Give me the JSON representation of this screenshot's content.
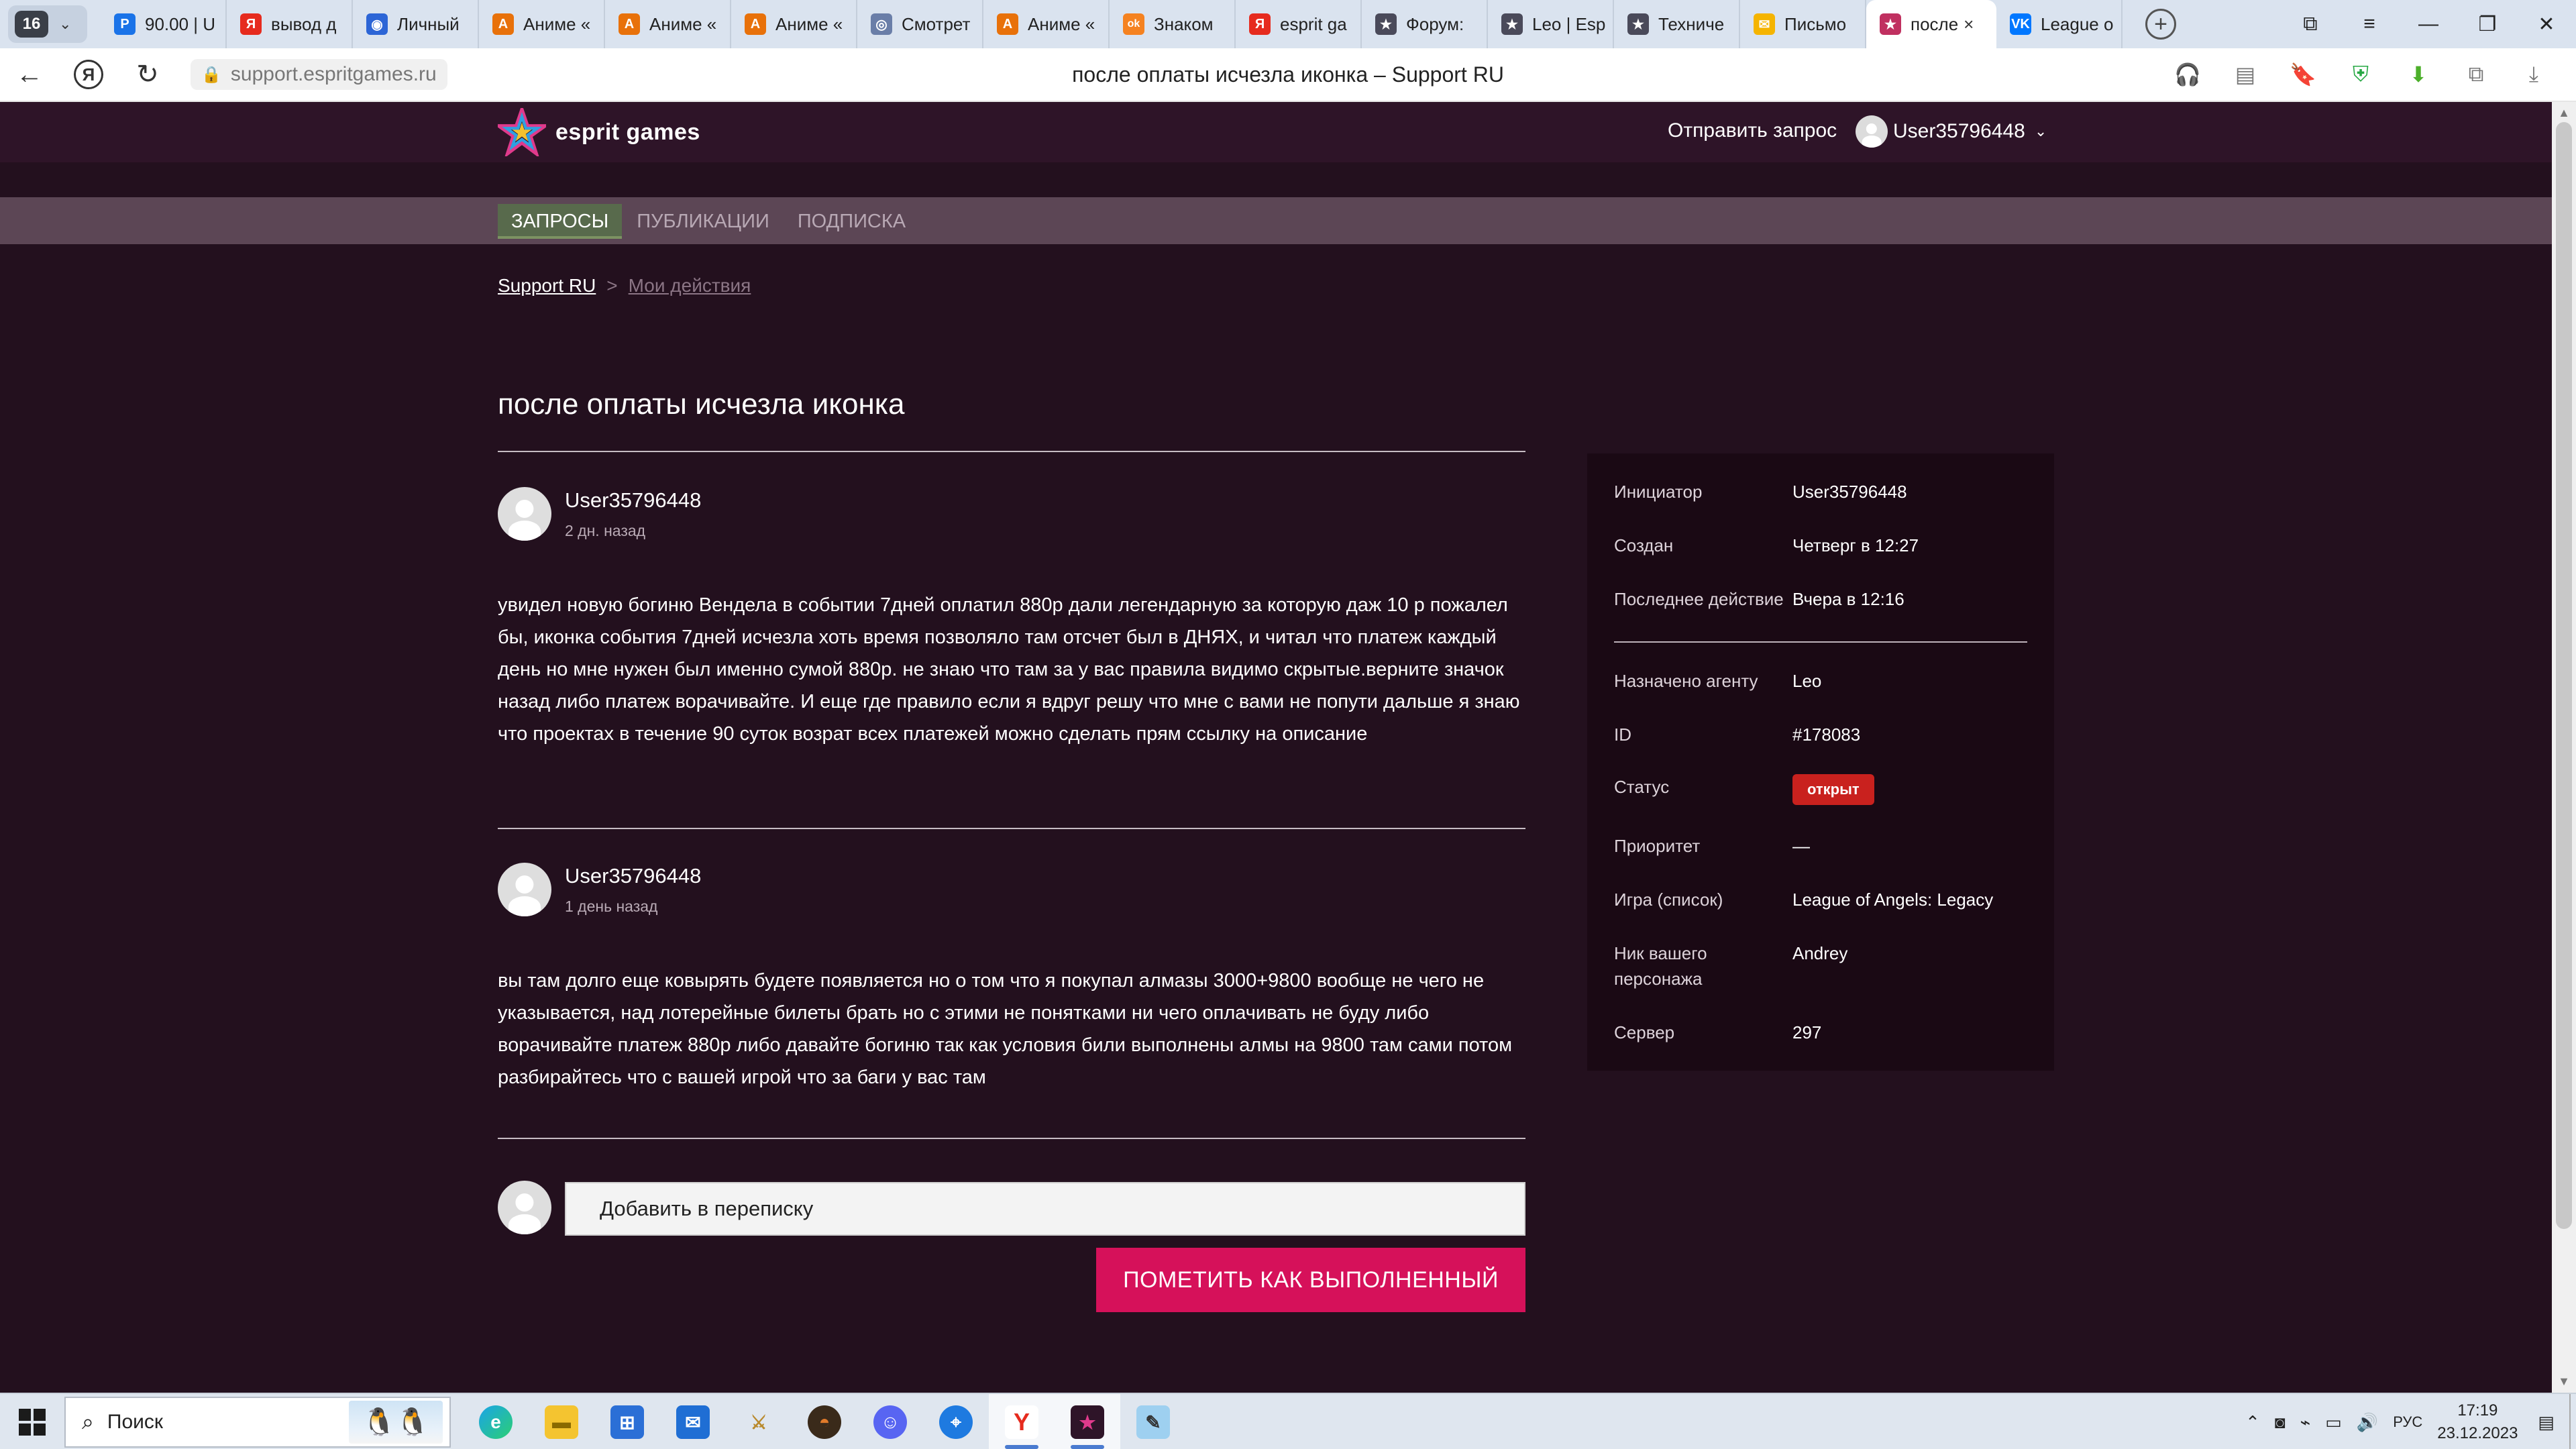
{
  "browser": {
    "tab_count": "16",
    "tabs": [
      {
        "title": "90.00 | U",
        "icon": "P",
        "color": "#1a73e8"
      },
      {
        "title": "вывод д",
        "icon": "Я",
        "color": "#e62b1e"
      },
      {
        "title": "Личный",
        "icon": "◉",
        "color": "#2c65d6"
      },
      {
        "title": "Аниме «",
        "icon": "A",
        "color": "#e8710a"
      },
      {
        "title": "Аниме «",
        "icon": "A",
        "color": "#e8710a"
      },
      {
        "title": "Аниме «",
        "icon": "A",
        "color": "#e8710a"
      },
      {
        "title": "Смотрет",
        "icon": "◎",
        "color": "#6a7ea8"
      },
      {
        "title": "Аниме «",
        "icon": "A",
        "color": "#e8710a"
      },
      {
        "title": "Знаком",
        "icon": "ok",
        "color": "#f58220"
      },
      {
        "title": "esprit ga",
        "icon": "Я",
        "color": "#e62b1e"
      },
      {
        "title": "Форум:",
        "icon": "★",
        "color": "#4a4a5a"
      },
      {
        "title": "Leo | Esp",
        "icon": "★",
        "color": "#4a4a5a"
      },
      {
        "title": "Техниче",
        "icon": "★",
        "color": "#4a4a5a"
      },
      {
        "title": "Письмо",
        "icon": "✉",
        "color": "#f5b400"
      }
    ],
    "active_tab": {
      "title": "после",
      "icon": "★",
      "color": "#c03060"
    },
    "last_tab": {
      "title": "League о",
      "icon": "VK",
      "color": "#0077ff"
    },
    "url": "support.espritgames.ru",
    "page_title": "после оплаты исчезла иконка – Support RU"
  },
  "site": {
    "brand": "esprit games",
    "send_request": "Отправить запрос",
    "username": "User35796448",
    "nav": [
      "ЗАПРОСЫ",
      "ПУБЛИКАЦИИ",
      "ПОДПИСКА"
    ],
    "breadcrumb": {
      "root": "Support RU",
      "separator": ">",
      "current": "Мои действия"
    }
  },
  "request": {
    "title": "после оплаты исчезла иконка",
    "comments": [
      {
        "author": "User35796448",
        "time": "2 дн. назад",
        "body": "увидел новую богиню Вендела в событии 7дней оплатил 880р дали легендарную за которую даж 10 р пожалел бы, иконка события 7дней исчезла хоть время позволяло там отсчет был в ДНЯХ, и читал что платеж каждый день но мне нужен был именно сумой 880р. не знаю что там за у вас правила видимо скрытые.верните значок назад либо платеж ворачивайте. И еще где правило если я вдруг решу что мне с вами не попути дальше я знаю что проектах в течение 90 суток возрат всех платежей можно сделать прям ссылку на описание"
      },
      {
        "author": "User35796448",
        "time": "1 день назад",
        "body": "вы там долго еще ковырять будете появляется но о том что я покупал алмазы 3000+9800 вообще не чего не указывается, над лотерейные билеты брать но с этими не понятками ни чего оплачивать не буду либо ворачивайте платеж 880р либо давайте богиню так как условия били выполнены алмы на 9800 там сами потом разбирайтесь что с вашей игрой что за баги у вас там"
      }
    ],
    "reply_placeholder": "Добавить в переписку",
    "mark_done_label": "ПОМЕТИТЬ КАК ВЫПОЛНЕННЫЙ",
    "accent_color": "#d6115a"
  },
  "info": {
    "initiator_label": "Инициатор",
    "initiator": "User35796448",
    "created_label": "Создан",
    "created": "Четверг в 12:27",
    "last_action_label": "Последнее действие",
    "last_action": "Вчера в 12:16",
    "agent_label": "Назначено агенту",
    "agent": "Leo",
    "id_label": "ID",
    "id": "#178083",
    "status_label": "Статус",
    "status": "открыт",
    "status_color": "#c9211e",
    "priority_label": "Приоритет",
    "priority": "—",
    "game_label": "Игра (список)",
    "game": "League of Angels: Legacy",
    "nick_label": "Ник вашего персонажа",
    "nick": "Andrey",
    "server_label": "Сервер",
    "server": "297"
  },
  "taskbar": {
    "search_placeholder": "Поиск",
    "lang": "РУС",
    "time": "17:19",
    "date": "23.12.2023"
  }
}
